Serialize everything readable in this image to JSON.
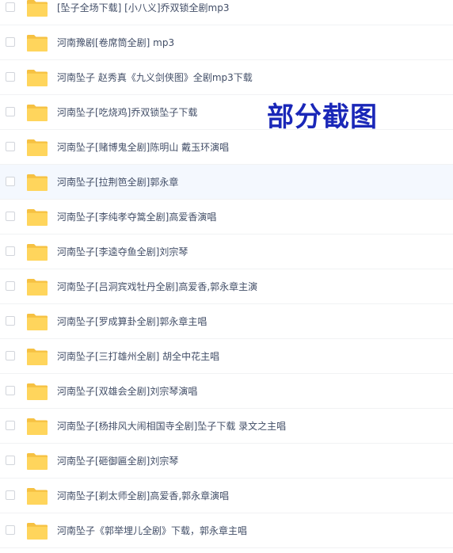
{
  "watermark": "部分截图",
  "folder_icon": "folder-icon",
  "accent_color": "#FFD14F",
  "files": [
    {
      "name": "[坠子全场下载] [小八义]乔双锁全剧mp3"
    },
    {
      "name": "河南豫剧[卷席筒全剧] mp3"
    },
    {
      "name": "河南坠子 赵秀真《九义剑侠图》全剧mp3下载"
    },
    {
      "name": "河南坠子[吃烧鸡]乔双锁坠子下载"
    },
    {
      "name": "河南坠子[赌博鬼全剧]陈明山 戴玉环演唱"
    },
    {
      "name": "河南坠子[拉荆笆全剧]郭永章",
      "selected": true
    },
    {
      "name": "河南坠子[李纯孝夺篙全剧]高爱香演唱"
    },
    {
      "name": "河南坠子[李逵夺鱼全剧]刘宗琴"
    },
    {
      "name": "河南坠子[吕洞宾戏牡丹全剧]高爱香,郭永章主演"
    },
    {
      "name": "河南坠子[罗成算卦全剧]郭永章主唱"
    },
    {
      "name": "河南坠子[三打雄州全剧] 胡全中花主唱"
    },
    {
      "name": "河南坠子[双雄会全剧]刘宗琴演唱"
    },
    {
      "name": "河南坠子[杨排风大闹相国寺全剧]坠子下载 录文之主唱"
    },
    {
      "name": "河南坠子[砸御匾全剧]刘宗琴"
    },
    {
      "name": "河南坠子[剃太师全剧]高爱香,郭永章演唱"
    },
    {
      "name": "河南坠子《郭举埋儿全剧》下载，郭永章主唱"
    }
  ]
}
